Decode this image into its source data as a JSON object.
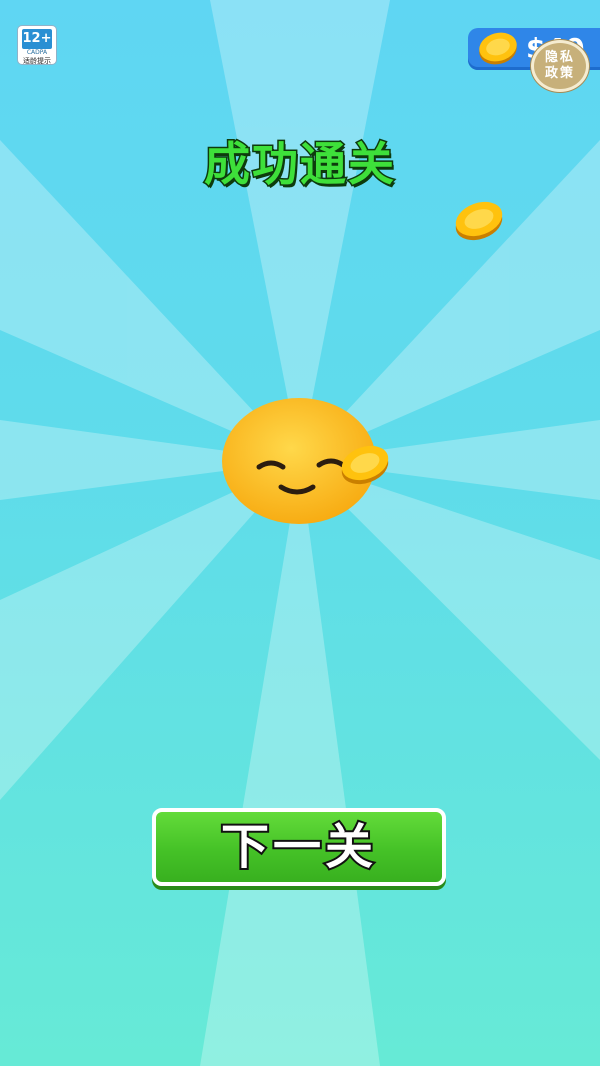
{
  "age_rating": {
    "label": "12+",
    "org": "CADPA",
    "tip": "适龄提示"
  },
  "coin_counter": {
    "amount": "$40",
    "icon": "gold-coin-icon"
  },
  "privacy": {
    "line1": "隐私",
    "line2": "政策"
  },
  "title": "成功通关",
  "mascot": {
    "icon": "smiling-face-icon"
  },
  "next_button": {
    "label": "下一关"
  },
  "colors": {
    "title_green": "#3ee03a",
    "button_green": "#45c227",
    "coin_gold": "#f2b705",
    "emoji_yellow": "#fcbd1e",
    "sky_top": "#5fd6f3",
    "sky_bottom": "#66ead6"
  }
}
